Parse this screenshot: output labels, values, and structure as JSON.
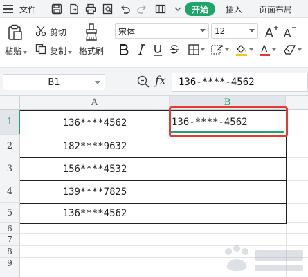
{
  "menu": {
    "file_label": "文件",
    "tabs": [
      {
        "label": "开始",
        "active": true
      },
      {
        "label": "插入",
        "active": false
      },
      {
        "label": "页面布局",
        "active": false
      }
    ],
    "quick_access_icons": [
      "hamburger-menu-icon",
      "save-icon",
      "export-icon",
      "print-icon",
      "print-preview-icon",
      "undo-icon",
      "redo-icon",
      "format-table-icon",
      "more-chevron-icon"
    ]
  },
  "ribbon": {
    "paste_label": "粘贴",
    "cut_label": "剪切",
    "copy_label": "复制",
    "format_painter_label": "格式刷",
    "font_name": "宋体",
    "font_size": "12",
    "format_buttons": [
      "bold-icon",
      "italic-icon",
      "underline-icon",
      "strikethrough-icon",
      "borders-icon",
      "cell-style-icon",
      "fill-color-icon",
      "font-color-icon",
      "clear-icon"
    ],
    "fill_color": "#f5c518",
    "font_color": "#e53935"
  },
  "formula_bar": {
    "name_box": "B1",
    "fx_label": "fx",
    "formula": "136-****-4562"
  },
  "grid": {
    "columns": [
      "A",
      "B"
    ],
    "active_column": "B",
    "rows": [
      "1",
      "2",
      "3",
      "4",
      "5",
      "6",
      "7",
      "8",
      "9"
    ],
    "active_row": "1",
    "column_a_values": [
      "136****4562",
      "182****9632",
      "156****4532",
      "139****7825",
      "136****4562"
    ],
    "column_b_values": [
      "136-****-4562",
      "",
      "",
      "",
      ""
    ],
    "selected_cell": "B1"
  },
  "colors": {
    "accent_green": "#1fa46b",
    "highlight_red": "#e53935"
  },
  "watermark_icon": "baidu-watermark-icon"
}
